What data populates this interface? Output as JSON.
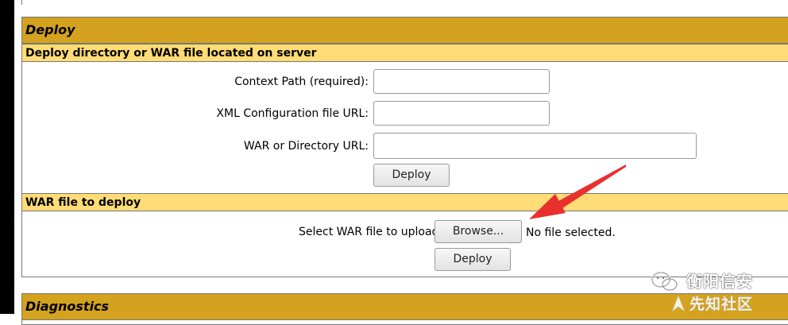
{
  "deploy": {
    "title": "Deploy",
    "server_section": {
      "header": "Deploy directory or WAR file located on server",
      "context_path_label": "Context Path (required):",
      "context_path_value": "",
      "xml_config_label": "XML Configuration file URL:",
      "xml_config_value": "",
      "war_dir_label": "WAR or Directory URL:",
      "war_dir_value": "",
      "deploy_button": "Deploy"
    },
    "upload_section": {
      "header": "WAR file to deploy",
      "select_label": "Select WAR file to upload",
      "browse_button": "Browse...",
      "file_status": "No file selected.",
      "deploy_button": "Deploy"
    }
  },
  "diagnostics": {
    "title": "Diagnostics"
  },
  "watermark": {
    "line1": "衡阳信安",
    "line2": "先知社区"
  },
  "colors": {
    "title_bar": "#d4a21e",
    "subheader": "#ffdc75",
    "arrow": "#e8312f"
  }
}
